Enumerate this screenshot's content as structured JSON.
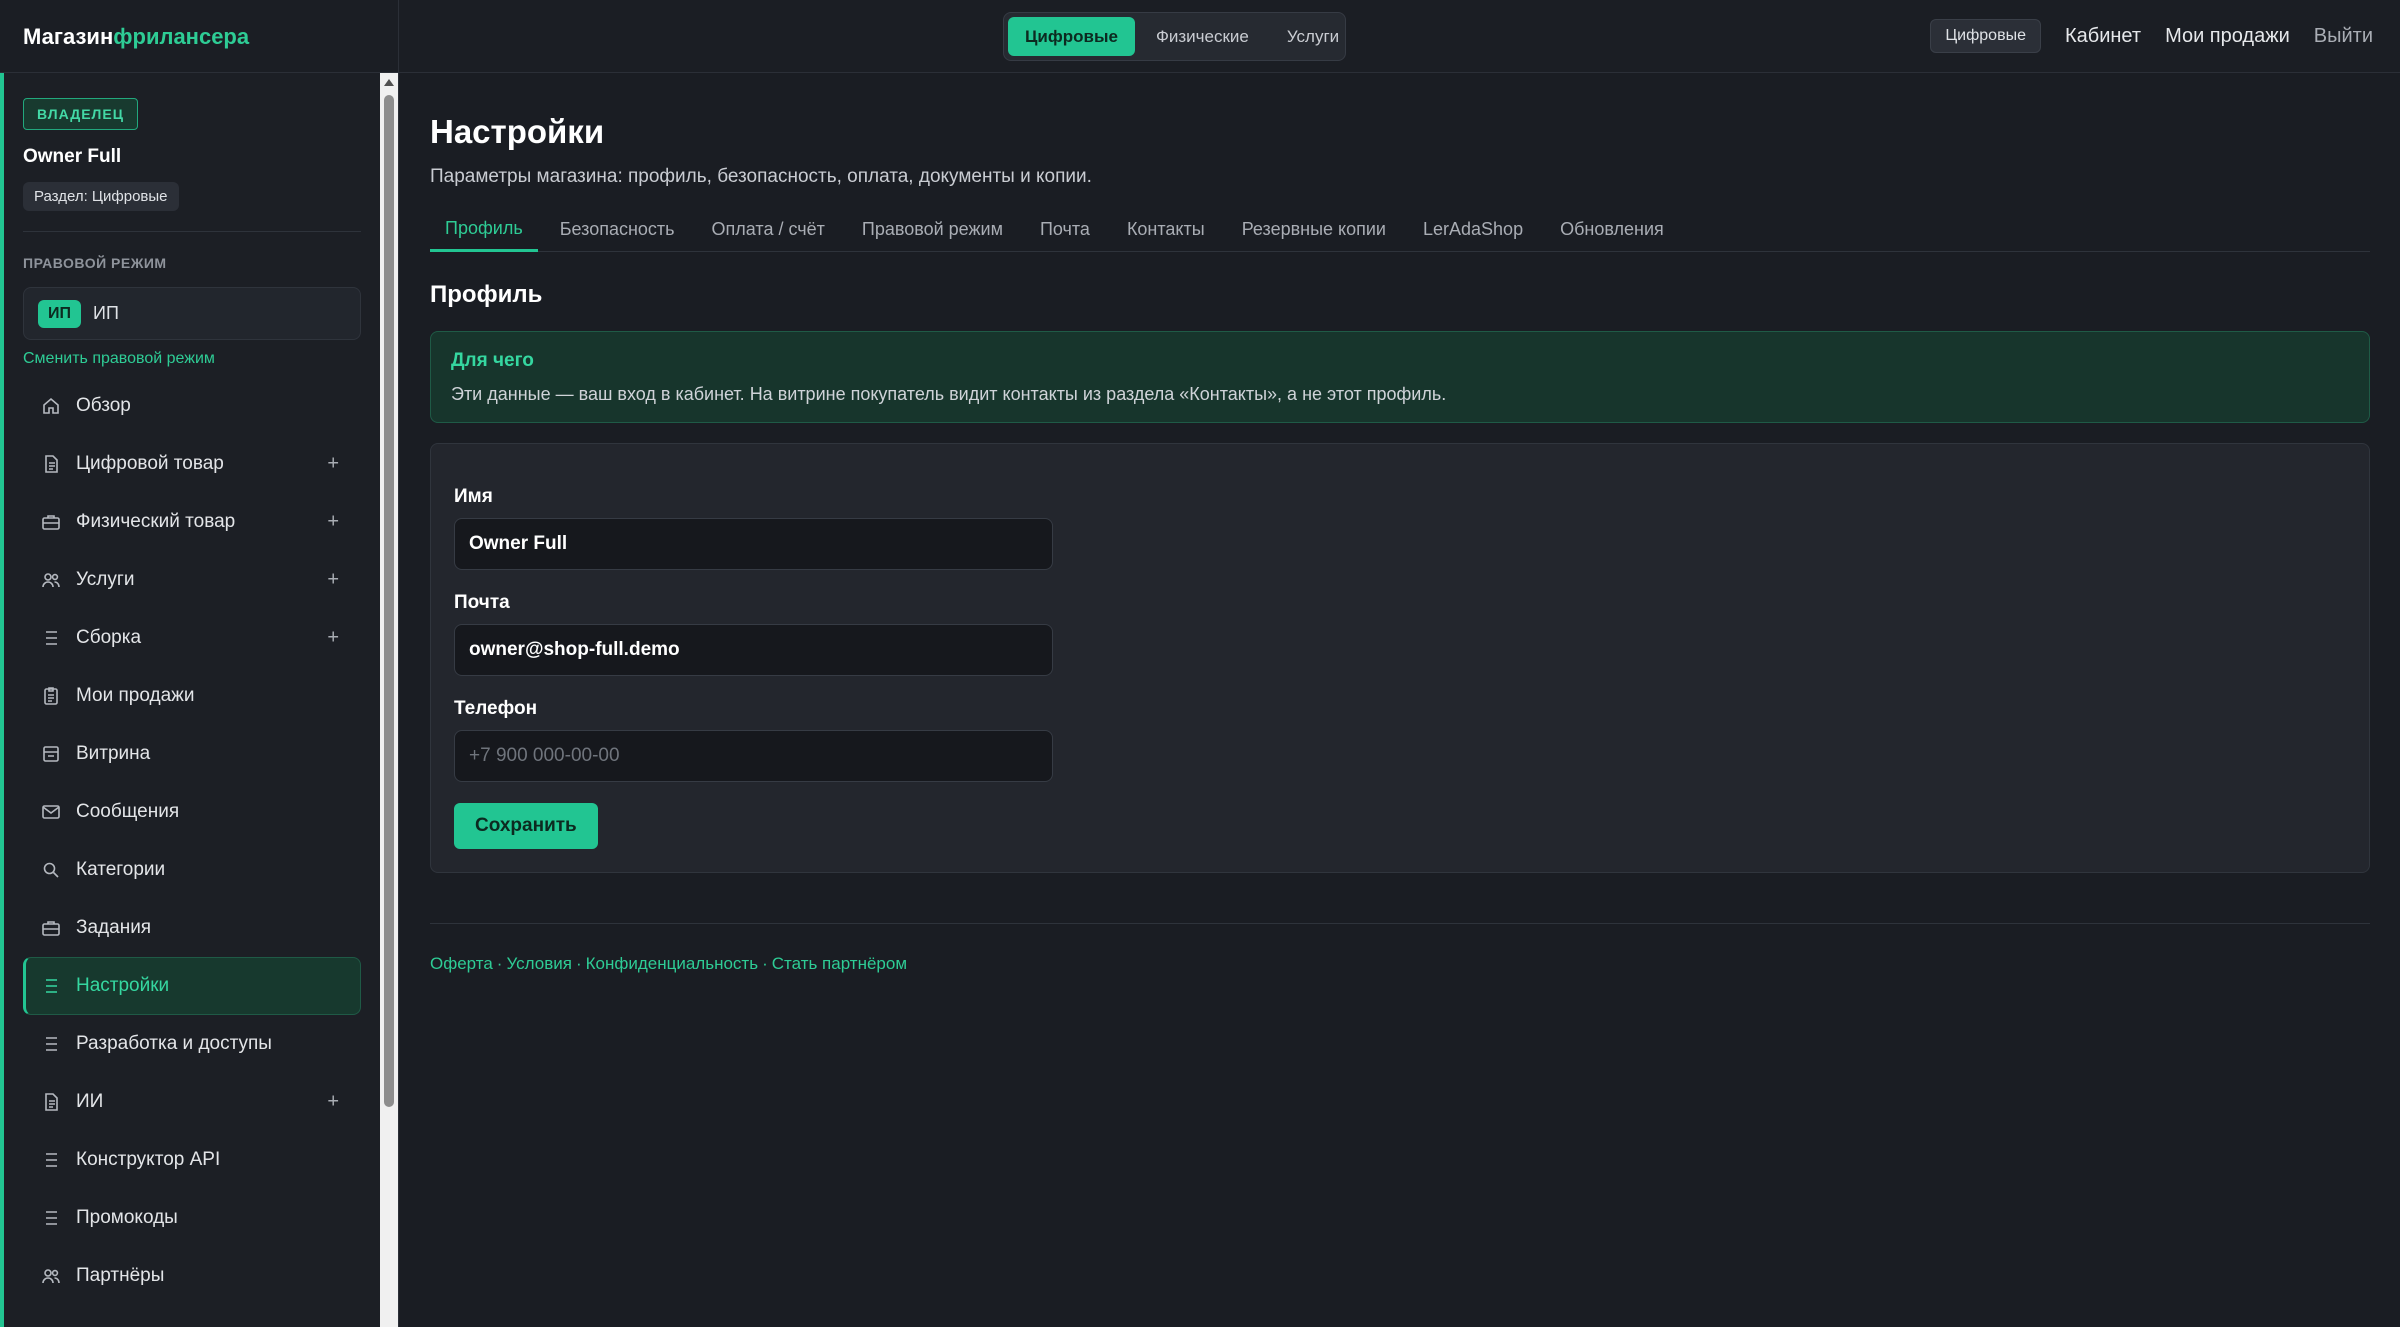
{
  "brand": {
    "part1": "Магазин",
    "part2": "фрилансера"
  },
  "segment": {
    "items": [
      {
        "label": "Цифровые",
        "active": true
      },
      {
        "label": "Физические",
        "active": false
      },
      {
        "label": "Услуги",
        "active": false
      }
    ]
  },
  "topnav": {
    "current_pill": "Цифровые",
    "cabinet": "Кабинет",
    "my_sales": "Мои продажи",
    "logout": "Выйти"
  },
  "sidebar": {
    "role_badge": "ВЛАДЕЛЕЦ",
    "user_name": "Owner Full",
    "section_pill": "Раздел: Цифровые",
    "legal_title": "ПРАВОВОЙ РЕЖИМ",
    "legal_tag": "ИП",
    "legal_value": "ИП",
    "legal_change": "Сменить правовой режим",
    "items": [
      {
        "label": "Обзор",
        "icon": "home-icon",
        "plus": ""
      },
      {
        "label": "Цифровой товар",
        "icon": "document-icon",
        "plus": "+"
      },
      {
        "label": "Физический товар",
        "icon": "briefcase-icon",
        "plus": "+"
      },
      {
        "label": "Услуги",
        "icon": "users-icon",
        "plus": "+"
      },
      {
        "label": "Сборка",
        "icon": "list-icon",
        "plus": "+"
      },
      {
        "label": "Мои продажи",
        "icon": "clipboard-icon",
        "plus": ""
      },
      {
        "label": "Витрина",
        "icon": "storefront-icon",
        "plus": ""
      },
      {
        "label": "Сообщения",
        "icon": "mail-icon",
        "plus": ""
      },
      {
        "label": "Категории",
        "icon": "search-icon",
        "plus": ""
      },
      {
        "label": "Задания",
        "icon": "briefcase-icon",
        "plus": ""
      },
      {
        "label": "Настройки",
        "icon": "list-icon",
        "plus": ""
      },
      {
        "label": "Разработка и доступы",
        "icon": "list-icon",
        "plus": ""
      },
      {
        "label": "ИИ",
        "icon": "document-icon",
        "plus": "+"
      },
      {
        "label": "Конструктор API",
        "icon": "list-icon",
        "plus": ""
      },
      {
        "label": "Промокоды",
        "icon": "list-icon",
        "plus": ""
      },
      {
        "label": "Партнёры",
        "icon": "users-icon",
        "plus": ""
      }
    ],
    "active_item": "Настройки"
  },
  "main": {
    "title": "Настройки",
    "subtitle": "Параметры магазина: профиль, безопасность, оплата, документы и копии.",
    "tabs": [
      {
        "label": "Профиль",
        "active": true
      },
      {
        "label": "Безопасность",
        "active": false
      },
      {
        "label": "Оплата / счёт",
        "active": false
      },
      {
        "label": "Правовой режим",
        "active": false
      },
      {
        "label": "Почта",
        "active": false
      },
      {
        "label": "Контакты",
        "active": false
      },
      {
        "label": "Резервные копии",
        "active": false
      },
      {
        "label": "LerAdaShop",
        "active": false
      },
      {
        "label": "Обновления",
        "active": false
      }
    ],
    "section_title": "Профиль",
    "info": {
      "title": "Для чего",
      "text": "Эти данные — ваш вход в кабинет. На витрине покупатель видит контакты из раздела «Контакты», а не этот профиль."
    },
    "form": {
      "name_label": "Имя",
      "name_value": "Owner Full",
      "email_label": "Почта",
      "email_value": "owner@shop-full.demo",
      "phone_label": "Телефон",
      "phone_value": "",
      "phone_placeholder": "+7 900 000-00-00",
      "save_label": "Сохранить"
    },
    "footer": {
      "links": [
        "Оферта",
        "Условия",
        "Конфиденциальность",
        "Стать партнёром"
      ],
      "separator": "·"
    }
  },
  "colors": {
    "accent": "#22c592",
    "accent_text": "#2ecc95",
    "background": "#1a1d23",
    "sidebar": "#1c1f25",
    "card": "#23262d"
  }
}
